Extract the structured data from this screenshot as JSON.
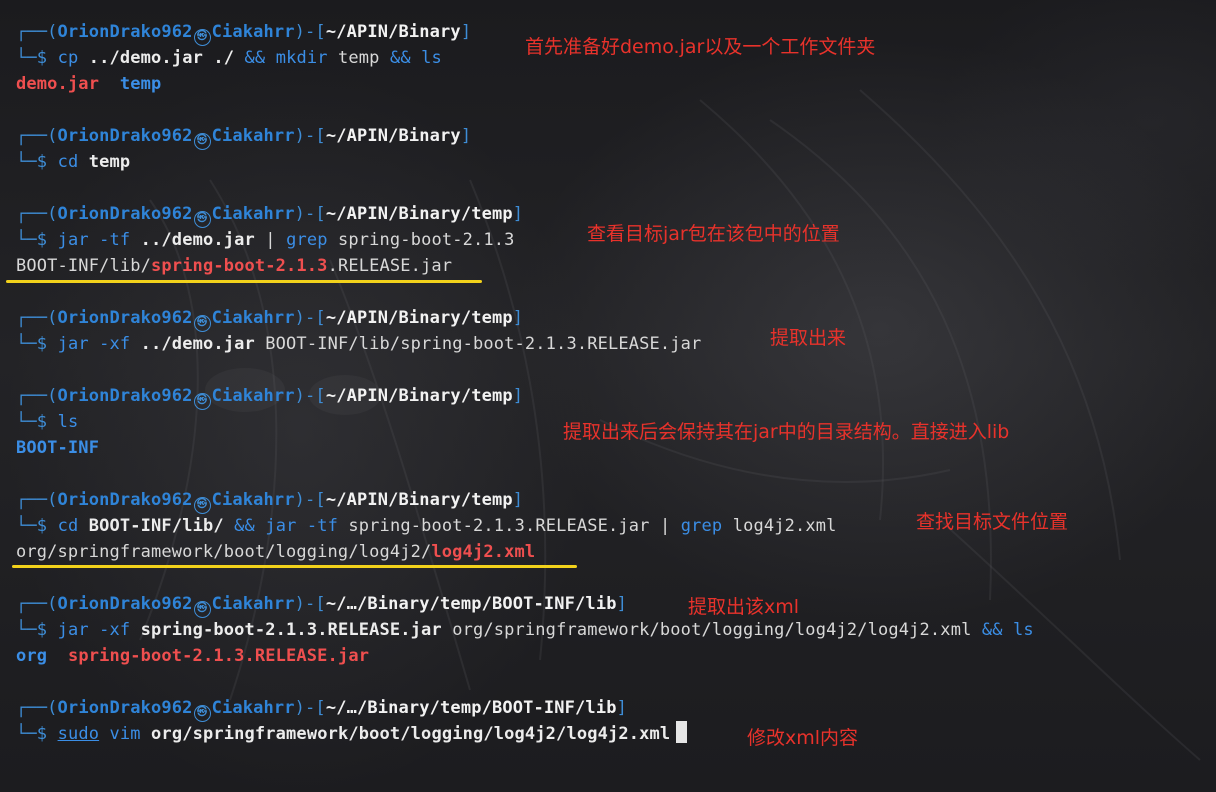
{
  "prompt": {
    "user": "OrionDrako962",
    "host": "Ciakahrr",
    "symbol": "㉿"
  },
  "blocks": [
    {
      "path": "~/APIN/Binary",
      "command": {
        "cmd": "cp",
        "a1": "../demo.jar",
        "a2": "./",
        "op1": "&&",
        "cmd2": "mkdir",
        "a3": "temp",
        "op2": "&&",
        "cmd3": "ls"
      },
      "output": [
        "demo.jar",
        "temp"
      ],
      "note": "首先准备好demo.jar以及一个工作文件夹"
    },
    {
      "path": "~/APIN/Binary",
      "command": {
        "cmd": "cd",
        "a1": "temp"
      }
    },
    {
      "path": "~/APIN/Binary/temp",
      "command": {
        "cmd": "jar",
        "flag": "-tf",
        "a1": "../demo.jar",
        "pipe": "|",
        "cmd2": "grep",
        "a2": "spring-boot-2.1.3"
      },
      "output": {
        "prefix": "BOOT-INF/lib/",
        "match": "spring-boot-2.1.3",
        "suffix": ".RELEASE.jar"
      },
      "note": "查看目标jar包在该包中的位置"
    },
    {
      "path": "~/APIN/Binary/temp",
      "command": {
        "cmd": "jar",
        "flag": "-xf",
        "a1": "../demo.jar",
        "a2": "BOOT-INF/lib/spring-boot-2.1.3.RELEASE.jar"
      },
      "note": "提取出来"
    },
    {
      "path": "~/APIN/Binary/temp",
      "command": {
        "cmd": "ls"
      },
      "output": "BOOT-INF",
      "note": "提取出来后会保持其在jar中的目录结构。直接进入lib"
    },
    {
      "path": "~/APIN/Binary/temp",
      "command": {
        "cmd": "cd",
        "a1": "BOOT-INF/lib/",
        "op1": "&&",
        "cmd2": "jar",
        "flag": "-tf",
        "a2": "spring-boot-2.1.3.RELEASE.jar",
        "pipe": "|",
        "cmd3": "grep",
        "a3": "log4j2.xml"
      },
      "output": {
        "prefix": "org/springframework/boot/logging/log4j2/",
        "match": "log4j2.xml"
      },
      "note": "查找目标文件位置"
    },
    {
      "path": "~/…/Binary/temp/BOOT-INF/lib",
      "command": {
        "cmd": "jar",
        "flag": "-xf",
        "a1": "spring-boot-2.1.3.RELEASE.jar",
        "a2": "org/springframework/boot/logging/log4j2/log4j2.xml",
        "op1": "&&",
        "cmd2": "ls"
      },
      "output": [
        "org",
        "spring-boot-2.1.3.RELEASE.jar"
      ],
      "note": "提取出该xml"
    },
    {
      "path": "~/…/Binary/temp/BOOT-INF/lib",
      "command": {
        "cmd": "sudo",
        "cmd2": "vim",
        "a1": "org/springframework/boot/logging/log4j2/log4j2.xml"
      },
      "note": "修改xml内容"
    }
  ],
  "colors": {
    "accent_blue": "#3b8ee6",
    "error_red": "#ef4f4f",
    "annotation_red": "#e8322b",
    "highlight_yellow": "#f2d21b"
  }
}
